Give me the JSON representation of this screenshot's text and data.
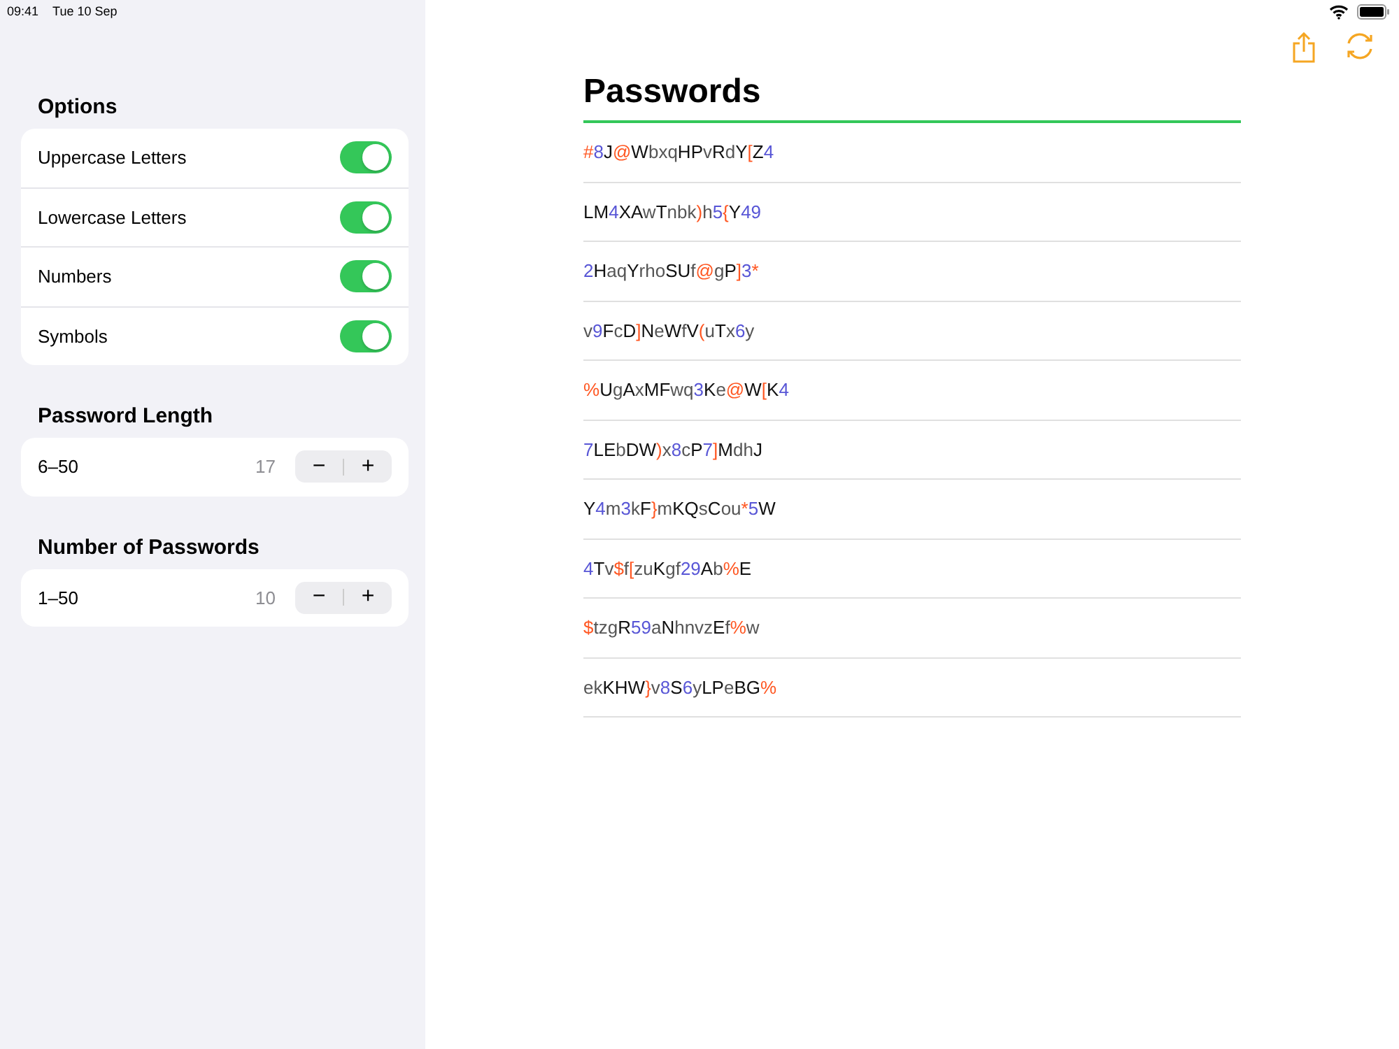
{
  "status_bar": {
    "time": "09:41",
    "date": "Tue 10 Sep"
  },
  "options": {
    "title": "Options",
    "items": [
      {
        "label": "Uppercase Letters",
        "on": true
      },
      {
        "label": "Lowercase Letters",
        "on": true
      },
      {
        "label": "Numbers",
        "on": true
      },
      {
        "label": "Symbols",
        "on": true
      }
    ]
  },
  "steppers": [
    {
      "title": "Password Length",
      "range": "6–50",
      "value": "17",
      "minus": "−",
      "plus": "+"
    },
    {
      "title": "Number of Passwords",
      "range": "1–50",
      "value": "10",
      "minus": "−",
      "plus": "+"
    }
  ],
  "passwords": {
    "title": "Passwords",
    "items": [
      "#8J@WbxqHPvRdY[Z4",
      "LM4XAwTnbk)h5{Y49",
      "2HaqYrhoSUf@gP]3*",
      "v9FcD]NeWfV(uTx6y",
      "%UgAxMFwq3Ke@W[K4",
      "7LEbDW)x8cP7]MdhJ",
      "Y4m3kF}mKQsCou*5W",
      "4Tv$f[zuKgf29Ab%E",
      "$tzgR59aNhnvzEf%w",
      "ekKHW}v8S6yLPeBG%"
    ]
  }
}
